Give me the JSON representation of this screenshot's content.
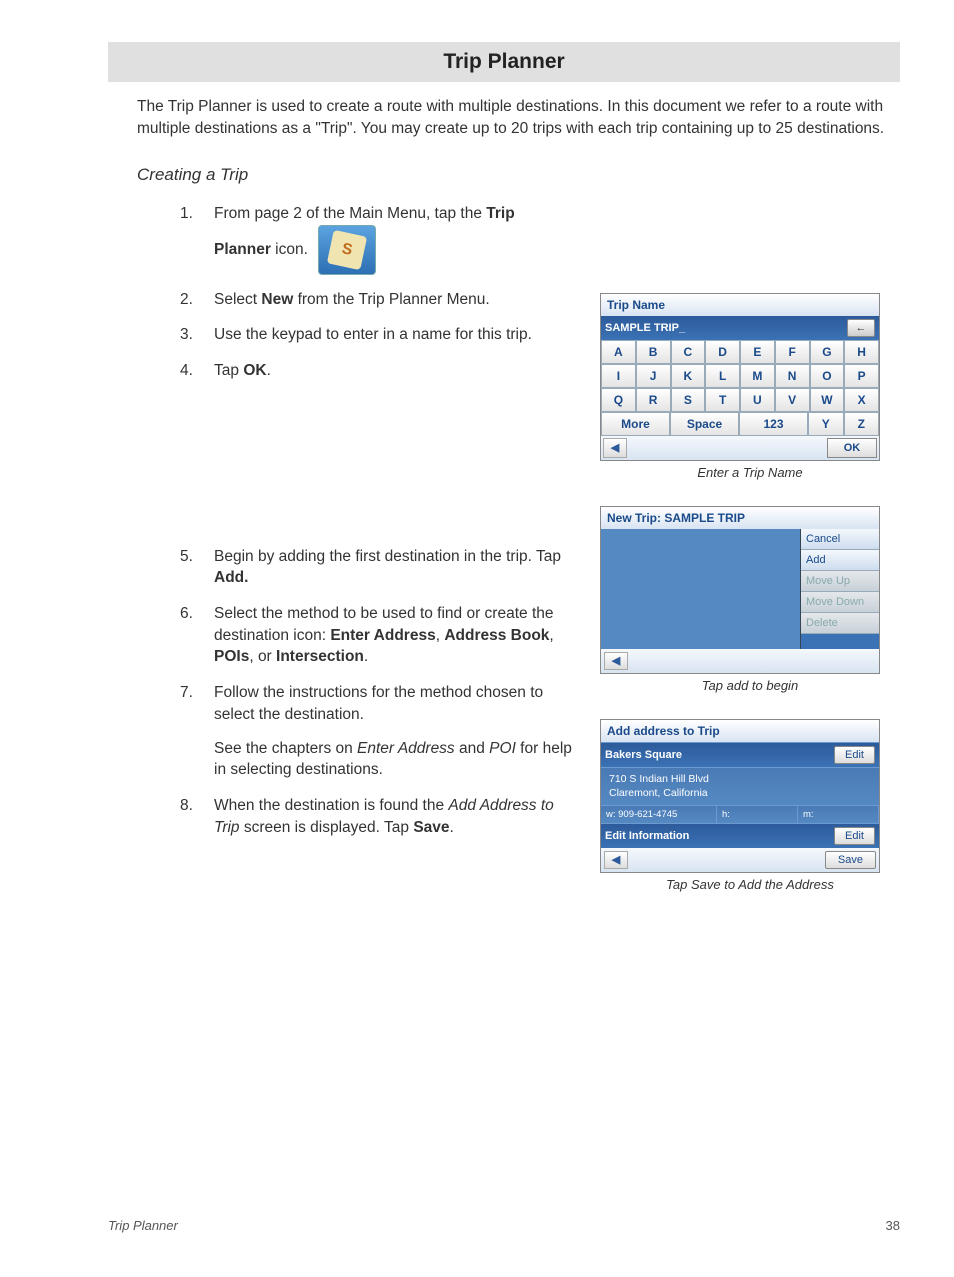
{
  "header": {
    "title": "Trip Planner"
  },
  "intro": "The Trip Planner is used to create a route with multiple destinations.  In this document we refer to a route with multiple destinations as a \"Trip\".  You may create up to 20 trips with each trip containing up to 25 destinations.",
  "section": {
    "title": "Creating a Trip"
  },
  "steps": {
    "s1a": "From page 2 of the Main Menu, tap the ",
    "s1b": "Trip Planner",
    "s1c": " icon.",
    "s2a": "Select ",
    "s2b": "New",
    "s2c": " from the Trip Planner Menu.",
    "s3": "Use the keypad to enter in a name for this trip.",
    "s4a": "Tap ",
    "s4b": "OK",
    "s4c": ".",
    "s5a": "Begin by adding the first destination in the trip.  Tap ",
    "s5b": "Add.",
    "s6a": "Select the method to be used to find or create the destination icon: ",
    "s6b": "Enter Address",
    "s6c": ", ",
    "s6d": "Address Book",
    "s6e": ", ",
    "s6f": "POIs",
    "s6g": ", or ",
    "s6h": "Intersection",
    "s6i": ".",
    "s7": "Follow the instructions for the method chosen to select the destination.",
    "s7suba": "See the chapters on ",
    "s7subb": "Enter Address",
    "s7subc": " and ",
    "s7subd": "POI",
    "s7sube": " for help in selecting destinations.",
    "s8a": "When the destination is found the ",
    "s8b": "Add Address to Trip",
    "s8c": " screen is displayed.  Tap ",
    "s8d": "Save",
    "s8e": "."
  },
  "keypad": {
    "title": "Trip Name",
    "value": "SAMPLE TRIP_",
    "bksp": "←",
    "keys_r1": [
      "A",
      "B",
      "C",
      "D",
      "E",
      "F",
      "G",
      "H"
    ],
    "keys_r2": [
      "I",
      "J",
      "K",
      "L",
      "M",
      "N",
      "O",
      "P"
    ],
    "keys_r3": [
      "Q",
      "R",
      "S",
      "T",
      "U",
      "V",
      "W",
      "X"
    ],
    "more": "More",
    "space": "Space",
    "num": "123",
    "y": "Y",
    "z": "Z",
    "back": "◀",
    "ok": "OK",
    "caption": "Enter a Trip Name"
  },
  "tripscreen": {
    "title": "New Trip: SAMPLE TRIP",
    "actions": {
      "cancel": "Cancel",
      "add": "Add",
      "moveup": "Move Up",
      "movedown": "Move Down",
      "delete": "Delete"
    },
    "back": "◀",
    "caption": "Tap add to begin"
  },
  "addrscreen": {
    "title": "Add address to Trip",
    "name": "Bakers Square",
    "edit": "Edit",
    "line1": "710 S Indian Hill Blvd",
    "line2": "Claremont, California",
    "phone_w_label": "w:",
    "phone_w": "909-621-4745",
    "phone_h_label": "h:",
    "phone_m_label": "m:",
    "editinfo": "Edit Information",
    "back": "◀",
    "save": "Save",
    "caption": "Tap Save to Add the Address"
  },
  "footer": {
    "title": "Trip Planner",
    "page": "38"
  }
}
